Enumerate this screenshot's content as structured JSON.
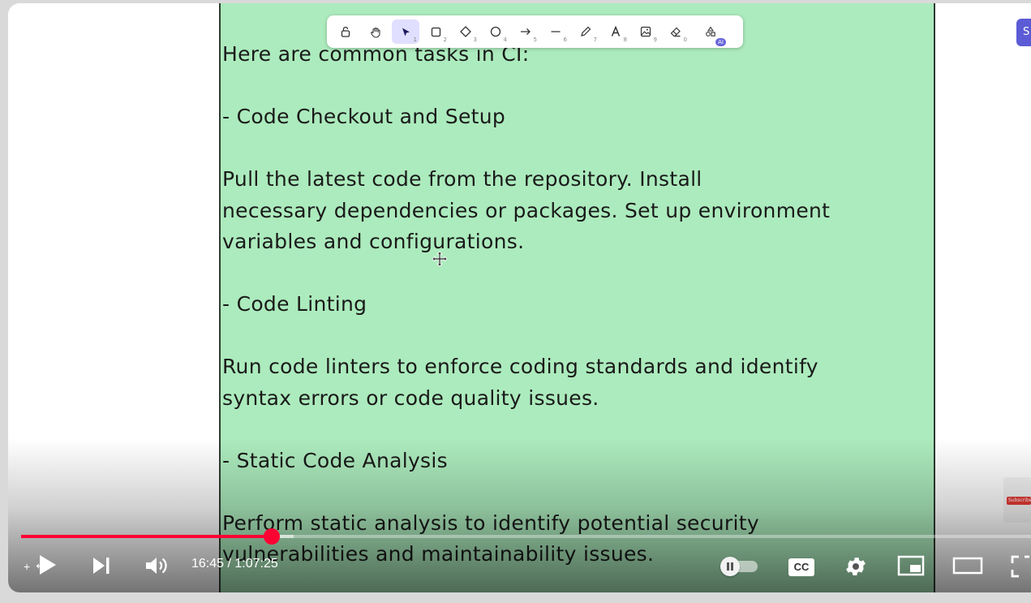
{
  "document": {
    "lines": [
      "Here are common tasks in CI:",
      "",
      "- Code Checkout and Setup",
      "",
      "Pull the latest code from the repository. Install",
      "necessary dependencies or packages. Set up environment",
      "variables and configurations.",
      "",
      "- Code Linting",
      "",
      "Run code linters to enforce coding standards and identify",
      "syntax errors or code quality issues.",
      "",
      "- Static Code Analysis",
      "",
      "Perform static analysis to identify potential security",
      "vulnerabilities and maintainability issues."
    ],
    "background_color": "#acebbd"
  },
  "toolbar": {
    "tools": [
      {
        "name": "lock",
        "icon": "lock-icon",
        "key": ""
      },
      {
        "name": "hand",
        "icon": "hand-icon",
        "key": ""
      },
      {
        "name": "selection",
        "icon": "pointer-icon",
        "key": "1",
        "active": true
      },
      {
        "name": "rectangle",
        "icon": "rectangle-icon",
        "key": "2"
      },
      {
        "name": "diamond",
        "icon": "diamond-icon",
        "key": "3"
      },
      {
        "name": "ellipse",
        "icon": "ellipse-icon",
        "key": "4"
      },
      {
        "name": "arrow",
        "icon": "arrow-icon",
        "key": "5"
      },
      {
        "name": "line",
        "icon": "line-icon",
        "key": "6"
      },
      {
        "name": "draw",
        "icon": "pencil-icon",
        "key": "7"
      },
      {
        "name": "text",
        "icon": "text-icon",
        "key": "8"
      },
      {
        "name": "image",
        "icon": "image-icon",
        "key": "9"
      },
      {
        "name": "eraser",
        "icon": "eraser-icon",
        "key": "0"
      },
      {
        "name": "more-shapes",
        "icon": "shapes-icon",
        "key": "",
        "badge": "AI"
      }
    ],
    "accent_color": "#6965db"
  },
  "share_button": {
    "label": "S"
  },
  "subscribe_badge": {
    "label": "Subscribe"
  },
  "player": {
    "time_current": "16:45",
    "time_separator": " / ",
    "time_total": "1:07:25",
    "progress_fraction": 0.2484,
    "buffered_fraction": 0.27,
    "cc_label": "CC",
    "plus_label": "+",
    "accent_color": "#ff0033"
  }
}
